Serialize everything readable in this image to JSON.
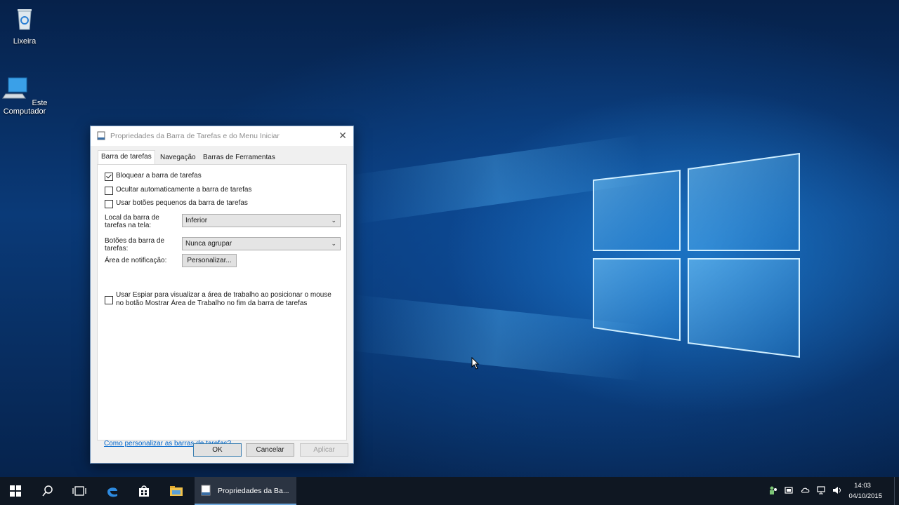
{
  "desktop": {
    "icons": [
      {
        "label": "Lixeira"
      },
      {
        "label": "Este Computador"
      }
    ]
  },
  "dialog": {
    "title": "Propriedades da Barra de Tarefas e do Menu Iniciar",
    "tabs": [
      "Barra de tarefas",
      "Navegação",
      "Barras de Ferramentas"
    ],
    "checkboxes": [
      {
        "label": "Bloquear a barra de tarefas",
        "checked": true
      },
      {
        "label": "Ocultar automaticamente a barra de tarefas",
        "checked": false
      },
      {
        "label": "Usar botões pequenos da barra de tarefas",
        "checked": false
      }
    ],
    "location_label": "Local da barra de tarefas na tela:",
    "location_value": "Inferior",
    "buttons_label": "Botões da barra de tarefas:",
    "buttons_value": "Nunca agrupar",
    "notification_label": "Área de notificação:",
    "customize_button": "Personalizar...",
    "peek_checkbox": {
      "label": "Usar Espiar para visualizar a área de trabalho ao posicionar o mouse no botão Mostrar Área de Trabalho no fim da barra de tarefas",
      "checked": false
    },
    "help_link": "Como personalizar as barras de tarefas?",
    "ok": "OK",
    "cancel": "Cancelar",
    "apply": "Aplicar"
  },
  "taskbar": {
    "active_app_label": "Propriedades da Ba...",
    "clock_time": "14:03",
    "clock_date": "04/10/2015"
  }
}
